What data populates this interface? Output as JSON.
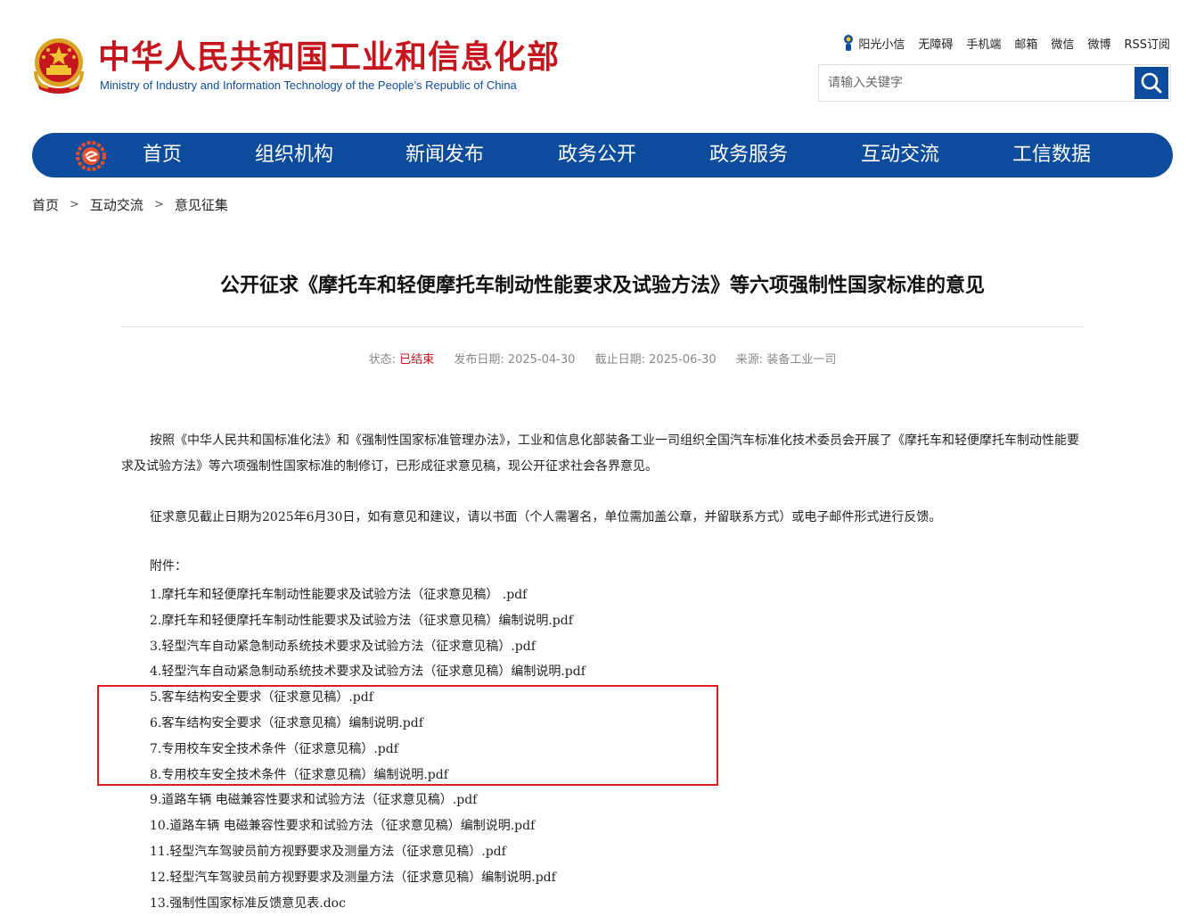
{
  "header": {
    "title_cn": "中华人民共和国工业和信息化部",
    "title_en": "Ministry of Industry and Information Technology of the People’s Republic of China",
    "emblem_icon": "national-emblem-icon"
  },
  "top_links": [
    "阳光小信",
    "无障碍",
    "手机端",
    "邮箱",
    "微信",
    "微博",
    "RSS订阅"
  ],
  "search": {
    "placeholder": "请输入关键字",
    "icon": "search-icon"
  },
  "nav": {
    "logo_icon": "miit-logo-icon",
    "items": [
      "首页",
      "组织机构",
      "新闻发布",
      "政务公开",
      "政务服务",
      "互动交流",
      "工信数据"
    ]
  },
  "breadcrumb": {
    "items": [
      "首页",
      "互动交流",
      "意见征集"
    ],
    "separator": ">"
  },
  "article": {
    "title": "公开征求《摩托车和轻便摩托车制动性能要求及试验方法》等六项强制性国家标准的意见",
    "meta": {
      "status_label": "状态:",
      "status_value": "已结束",
      "publish_label": "发布日期:",
      "publish_value": "2025-04-30",
      "deadline_label": "截止日期:",
      "deadline_value": "2025-06-30",
      "source_label": "来源:",
      "source_value": "装备工业一司"
    },
    "paragraph1": "按照《中华人民共和国标准化法》和《强制性国家标准管理办法》，工业和信息化部装备工业一司组织全国汽车标准化技术委员会开展了《摩托车和轻便摩托车制动性能要求及试验方法》等六项强制性国家标准的制修订，已形成征求意见稿，现公开征求社会各界意见。",
    "paragraph2": "征求意见截止日期为2025年6月30日，如有意见和建议，请以书面（个人需署名，单位需加盖公章，并留联系方式）或电子邮件形式进行反馈。",
    "attachments_label": "附件：",
    "attachments": [
      "1.摩托车和轻便摩托车制动性能要求及试验方法（征求意见稿） .pdf",
      "2.摩托车和轻便摩托车制动性能要求及试验方法（征求意见稿）编制说明.pdf",
      "3.轻型汽车自动紧急制动系统技术要求及试验方法（征求意见稿）.pdf",
      "4.轻型汽车自动紧急制动系统技术要求及试验方法（征求意见稿）编制说明.pdf",
      "5.客车结构安全要求（征求意见稿）.pdf",
      "6.客车结构安全要求（征求意见稿）编制说明.pdf",
      "7.专用校车安全技术条件（征求意见稿）.pdf",
      "8.专用校车安全技术条件（征求意见稿）编制说明.pdf",
      "9.道路车辆 电磁兼容性要求和试验方法（征求意见稿）.pdf",
      "10.道路车辆 电磁兼容性要求和试验方法（征求意见稿）编制说明.pdf",
      "11.轻型汽车驾驶员前方视野要求及测量方法（征求意见稿）.pdf",
      "12.轻型汽车驾驶员前方视野要求及测量方法（征求意见稿）编制说明.pdf",
      "13.强制性国家标准反馈意见表.doc"
    ]
  },
  "colors": {
    "brand_red": "#c4161c",
    "brand_blue": "#0d4c9c",
    "highlight_red": "#d81e1e"
  }
}
